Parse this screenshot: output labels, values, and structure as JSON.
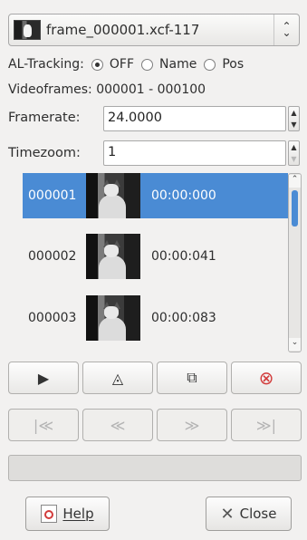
{
  "image_selector": {
    "value": "frame_000001.xcf-117",
    "arrow_icon": "combo-updown-arrow-icon"
  },
  "tracking": {
    "label": "AL-Tracking:",
    "options": [
      {
        "label": "OFF",
        "checked": true
      },
      {
        "label": "Name",
        "checked": false
      },
      {
        "label": "Pos",
        "checked": false
      }
    ]
  },
  "videoframes": {
    "text": "Videoframes: 000001 - 000100"
  },
  "framerate": {
    "label": "Framerate:",
    "value": "24.0000"
  },
  "timezoom": {
    "label": "Timezoom:",
    "value": "1"
  },
  "frames": [
    {
      "number": "000001",
      "time": "00:00:000",
      "selected": true
    },
    {
      "number": "000002",
      "time": "00:00:041",
      "selected": false
    },
    {
      "number": "000003",
      "time": "00:00:083",
      "selected": false
    }
  ],
  "playback_buttons": [
    {
      "icon": "play-icon",
      "glyph": "▶",
      "enabled": true
    },
    {
      "icon": "play-pingpong-icon",
      "glyph": "◬",
      "enabled": true
    },
    {
      "icon": "play-selection-icon",
      "glyph": "⧉",
      "enabled": true
    },
    {
      "icon": "stop-icon",
      "glyph": "⊗",
      "enabled": true
    }
  ],
  "navigation_buttons": [
    {
      "icon": "go-first-icon",
      "glyph": "|≪",
      "enabled": false
    },
    {
      "icon": "go-prev-icon",
      "glyph": "≪",
      "enabled": false
    },
    {
      "icon": "go-next-icon",
      "glyph": "≫",
      "enabled": false
    },
    {
      "icon": "go-last-icon",
      "glyph": "≫|",
      "enabled": false
    }
  ],
  "footer": {
    "help_label": "Help",
    "close_label": "Close"
  },
  "colors": {
    "selection": "#4a8bd4",
    "stop_red": "#d23b3b"
  }
}
